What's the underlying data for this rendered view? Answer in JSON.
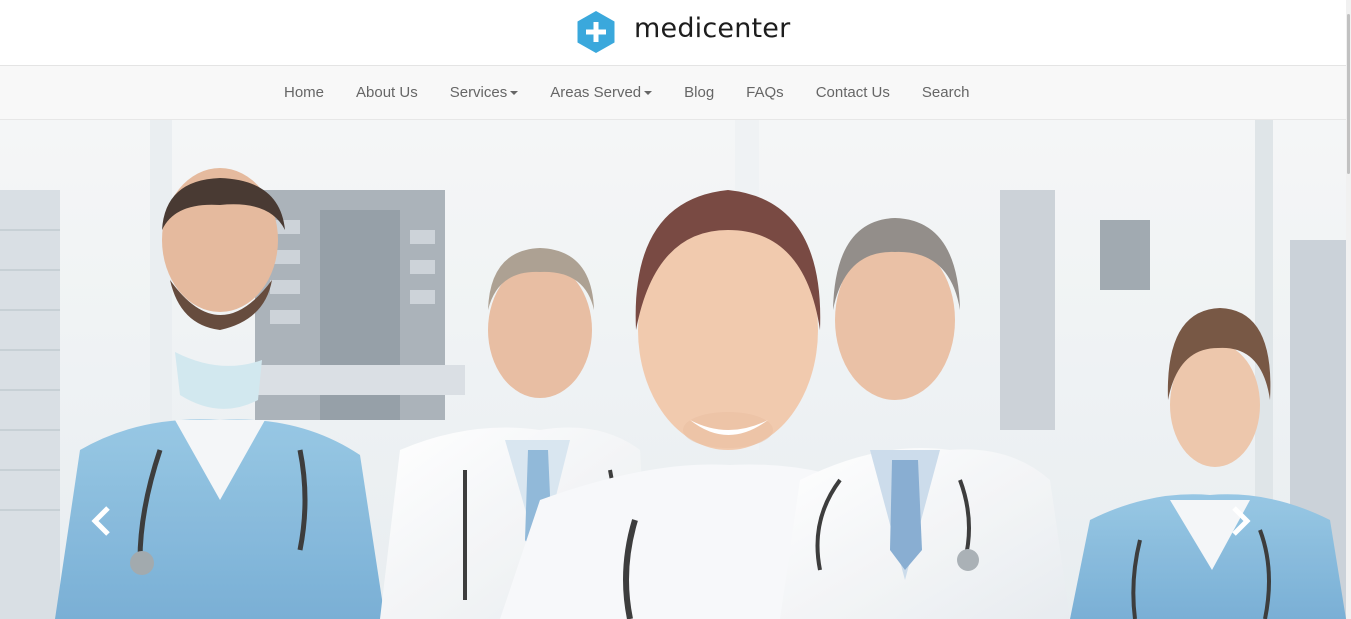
{
  "brand": {
    "name": "medicenter",
    "logo_icon": "plus-hexagon-icon",
    "accent_color": "#3aa8dc"
  },
  "nav": {
    "items": [
      {
        "label": "Home",
        "has_dropdown": false
      },
      {
        "label": "About Us",
        "has_dropdown": false
      },
      {
        "label": "Services",
        "has_dropdown": true
      },
      {
        "label": "Areas Served",
        "has_dropdown": true
      },
      {
        "label": "Blog",
        "has_dropdown": false
      },
      {
        "label": "FAQs",
        "has_dropdown": false
      },
      {
        "label": "Contact Us",
        "has_dropdown": false
      },
      {
        "label": "Search",
        "has_dropdown": false
      }
    ]
  },
  "hero": {
    "prev_icon": "chevron-left-icon",
    "next_icon": "chevron-right-icon"
  }
}
